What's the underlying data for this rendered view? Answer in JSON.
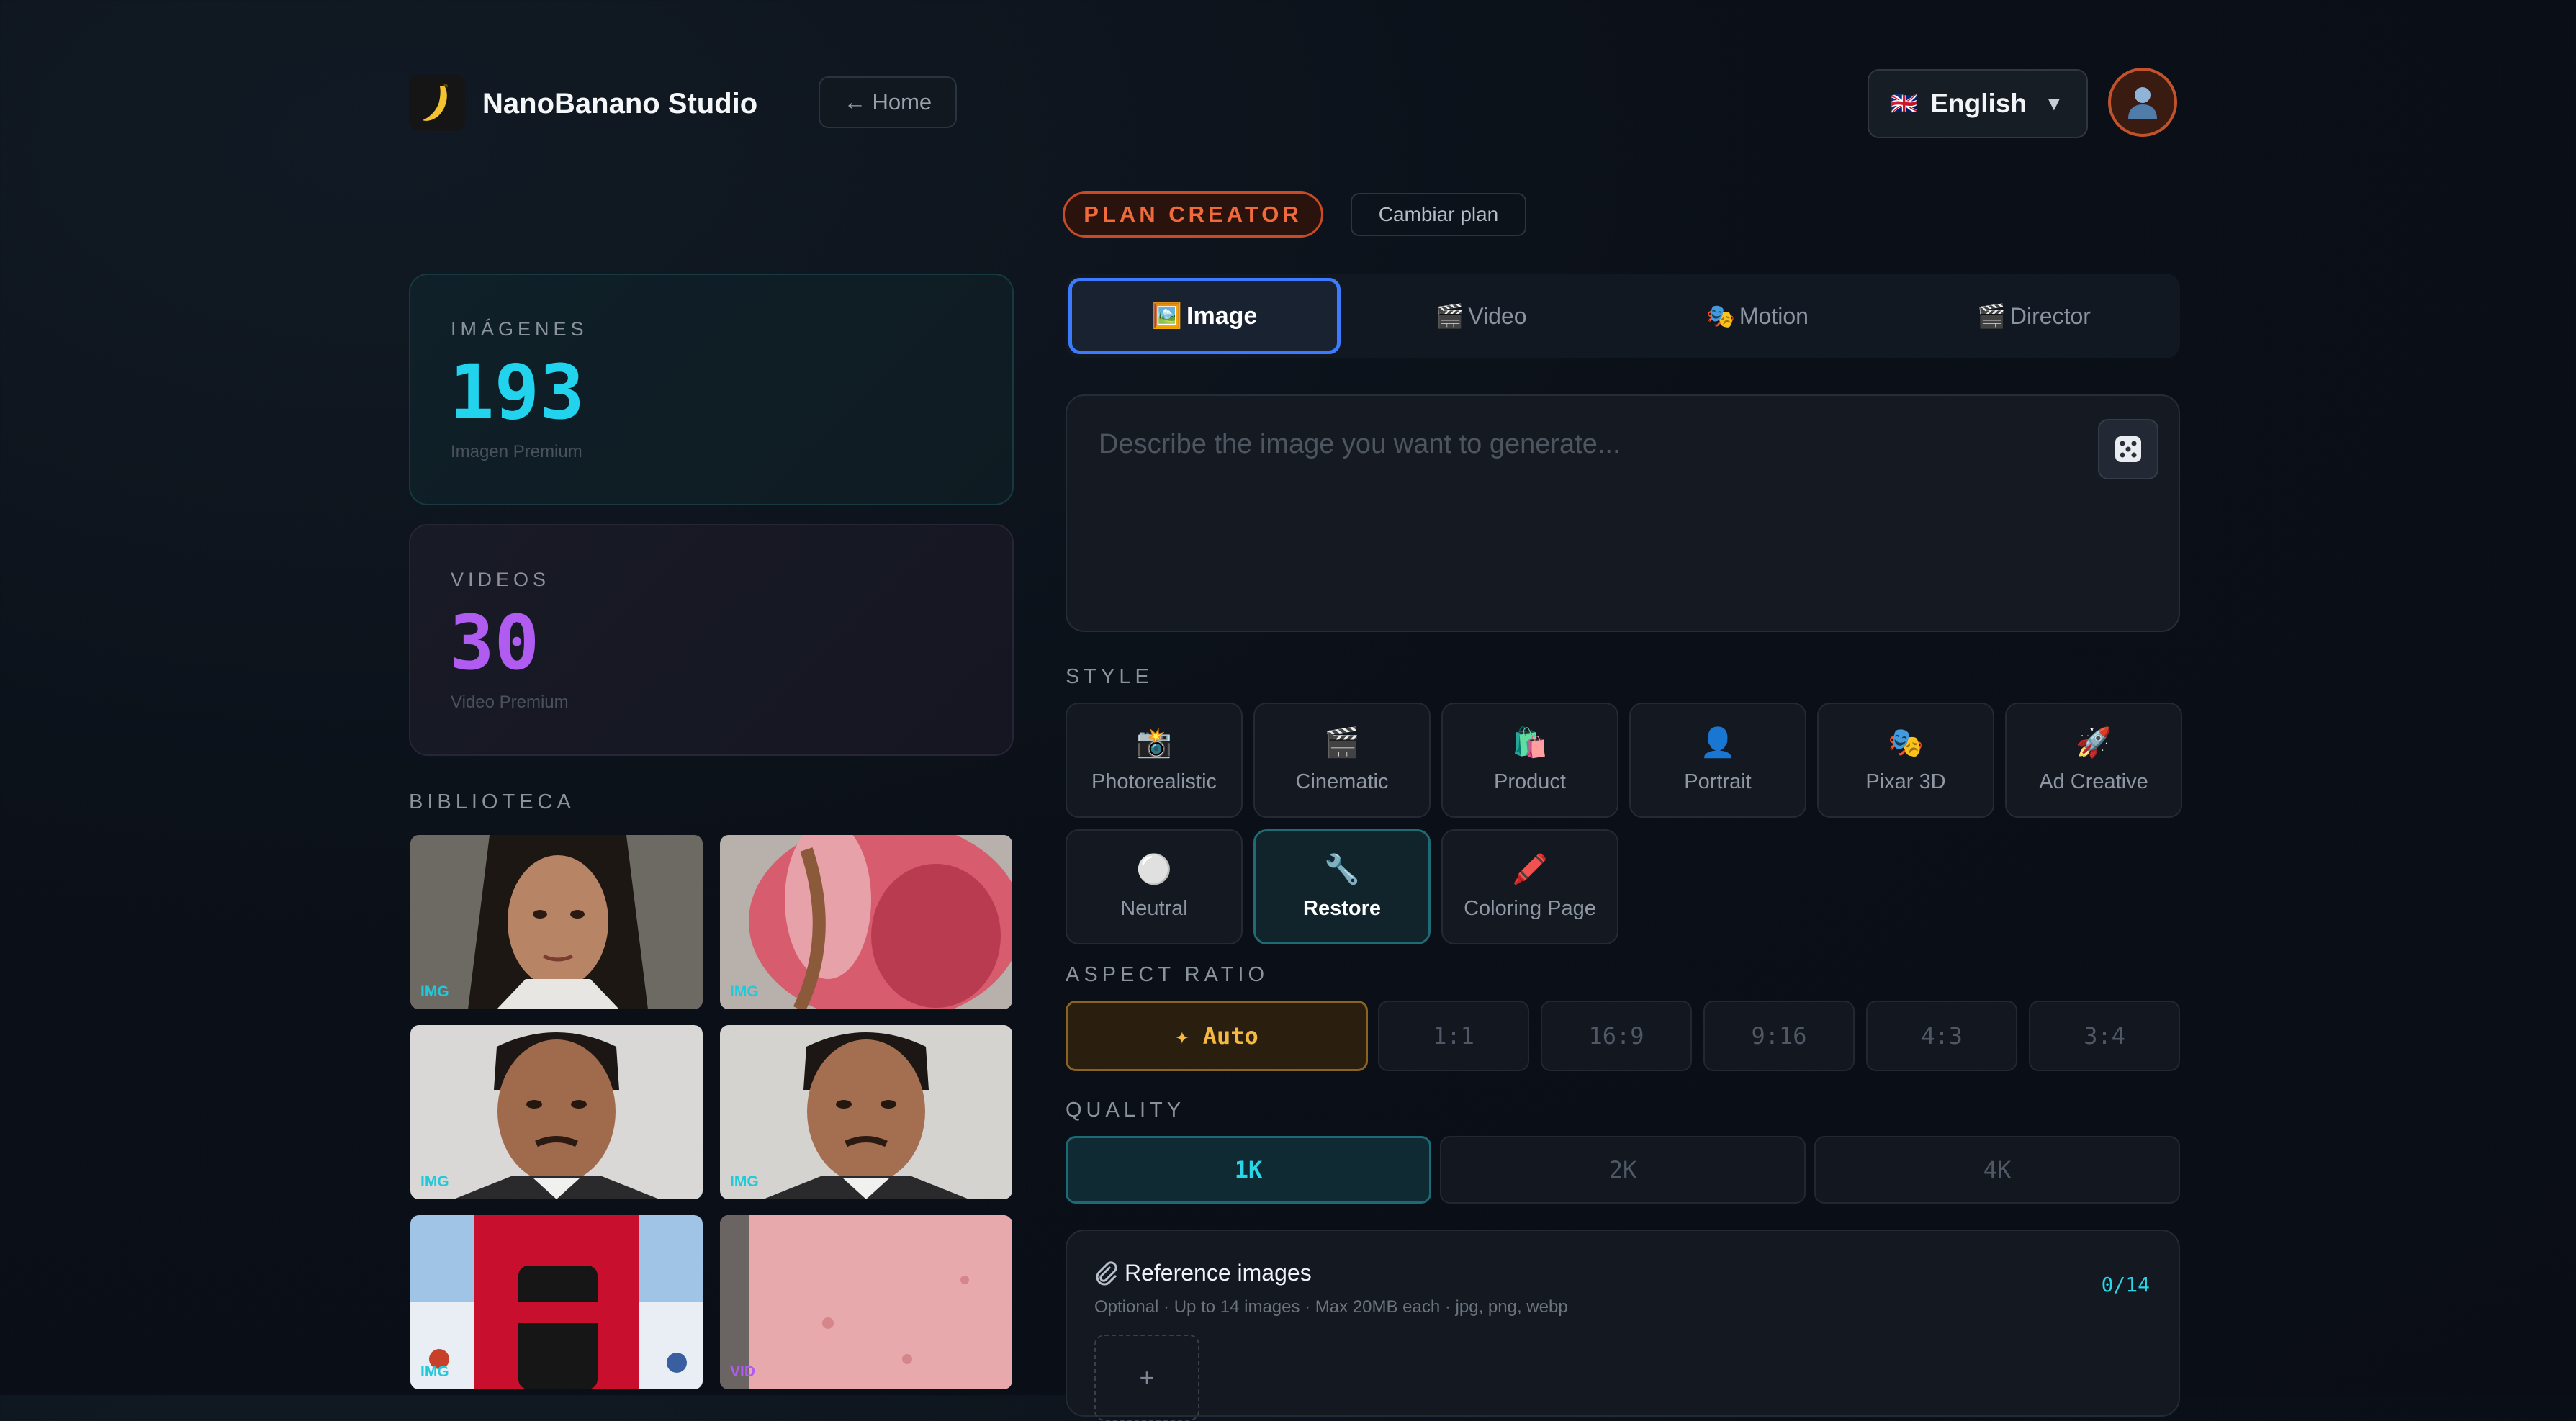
{
  "header": {
    "brand": "NanoBanano Studio",
    "home_label": "← Home",
    "language": "English",
    "language_flag": "🇬🇧",
    "dropdown_arrow": "▼"
  },
  "stats": {
    "images": {
      "label": "IMÁGENES",
      "value": "193",
      "sub": "Imagen Premium",
      "color": "#22d3ee"
    },
    "videos": {
      "label": "VIDEOS",
      "value": "30",
      "sub": "Video Premium",
      "color": "#b05cf0"
    }
  },
  "library": {
    "title": "BIBLIOTECA",
    "items": [
      {
        "tag": "IMG"
      },
      {
        "tag": "IMG"
      },
      {
        "tag": "IMG"
      },
      {
        "tag": "IMG"
      },
      {
        "tag": "IMG"
      },
      {
        "tag": "VID"
      }
    ]
  },
  "plan": {
    "badge": "PLAN CREATOR",
    "change": "Cambiar plan"
  },
  "tabs": [
    {
      "icon": "🖼️",
      "label": "Image"
    },
    {
      "icon": "🎬",
      "label": "Video"
    },
    {
      "icon": "🎭",
      "label": "Motion"
    },
    {
      "icon": "🎬",
      "label": "Director"
    }
  ],
  "prompt": {
    "placeholder": "Describe the image you want to generate..."
  },
  "style": {
    "title": "STYLE",
    "options": [
      {
        "icon": "📸",
        "label": "Photorealistic"
      },
      {
        "icon": "🎬",
        "label": "Cinematic"
      },
      {
        "icon": "🛍️",
        "label": "Product"
      },
      {
        "icon": "👤",
        "label": "Portrait"
      },
      {
        "icon": "🎭",
        "label": "Pixar 3D"
      },
      {
        "icon": "🚀",
        "label": "Ad Creative"
      },
      {
        "icon": "⚪",
        "label": "Neutral"
      },
      {
        "icon": "🔧",
        "label": "Restore"
      },
      {
        "icon": "🖍️",
        "label": "Coloring Page"
      }
    ],
    "selected": "Restore"
  },
  "aspect_ratio": {
    "title": "ASPECT RATIO",
    "options": [
      "✦ Auto",
      "1:1",
      "16:9",
      "9:16",
      "4:3",
      "3:4"
    ],
    "selected": "✦ Auto"
  },
  "quality": {
    "title": "QUALITY",
    "options": [
      "1K",
      "2K",
      "4K"
    ],
    "selected": "1K"
  },
  "reference": {
    "title": "Reference images",
    "subtitle": "Optional · Up to 14 images · Max 20MB each · jpg, png, webp",
    "count": "0/14",
    "add_label": "+"
  }
}
